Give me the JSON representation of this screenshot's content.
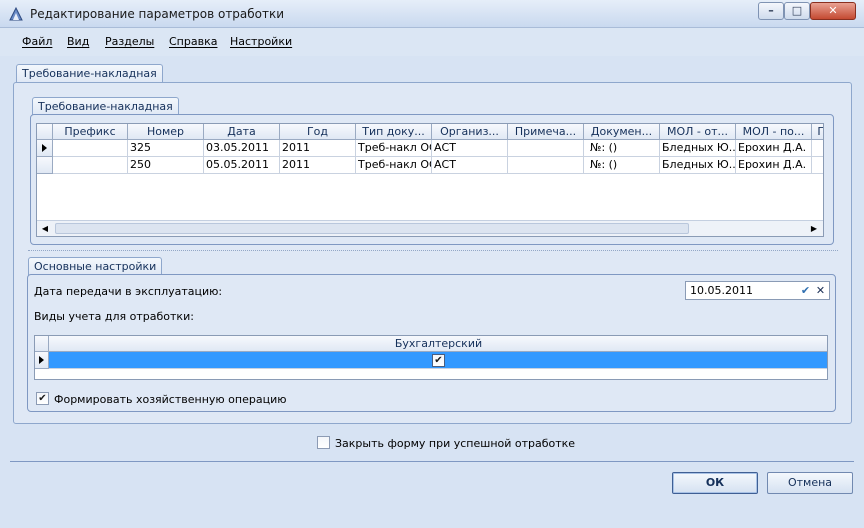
{
  "window": {
    "title": "Редактирование параметров отработки",
    "minimize_glyph": "–",
    "maximize_glyph": "□",
    "close_glyph": "✕"
  },
  "menu": [
    "Файл",
    "Вид",
    "Разделы",
    "Справка",
    "Настройки"
  ],
  "outer_tab": "Требование-накладная",
  "inner_tab": "Требование-накладная",
  "grid": {
    "columns": [
      "Префикс",
      "Номер",
      "Дата",
      "Год",
      "Тип доку...",
      "Организ...",
      "Примеча...",
      "Докумен...",
      "МОЛ - от...",
      "МОЛ - по...",
      "П"
    ],
    "rows": [
      [
        "",
        "325",
        "03.05.2011",
        "2011",
        "Треб-накл ОС",
        "АСТ",
        "",
        "№: ()",
        "Бледных Ю....",
        "Ерохин Д.А.",
        ""
      ],
      [
        "",
        "250",
        "05.05.2011",
        "2011",
        "Треб-накл ОС",
        "АСТ",
        "",
        "№: ()",
        "Бледных Ю....",
        "Ерохин Д.А.",
        ""
      ]
    ],
    "current_row": 0
  },
  "settings": {
    "tab": "Основные настройки",
    "date_label": "Дата передачи в эксплуатацию:",
    "date_value": "10.05.2011",
    "accounting_label": "Виды учета для отработки:",
    "accounting_column": "Бухгалтерский",
    "accounting_checked": true,
    "form_operation_label": "Формировать хозяйственную операцию",
    "form_operation_checked": true
  },
  "close_form_label": "Закрыть форму при успешной отработке",
  "close_form_checked": false,
  "buttons": {
    "ok": "ОК",
    "cancel": "Отмена"
  },
  "colors": {
    "selection": "#3399ff",
    "background": "#d7e3f3"
  }
}
